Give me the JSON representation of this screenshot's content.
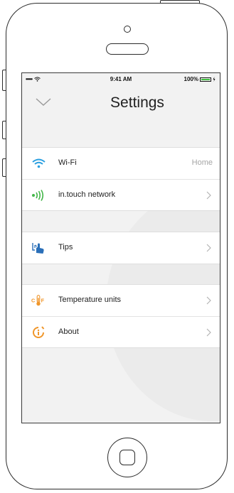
{
  "status": {
    "time": "9:41 AM",
    "battery_text": "100%",
    "signal": "•••••",
    "battery_level": 1.0
  },
  "header": {
    "title": "Settings"
  },
  "groups": [
    {
      "rows": [
        {
          "label": "Wi-Fi",
          "value": "Home",
          "icon": "wifi-icon"
        },
        {
          "label": "in.touch network",
          "icon": "network-signal-icon"
        }
      ]
    },
    {
      "rows": [
        {
          "label": "Tips",
          "icon": "hand-tips-icon"
        }
      ]
    },
    {
      "rows": [
        {
          "label": "Temperature units",
          "icon": "thermometer-icon",
          "icon_text_c": "C",
          "icon_text_f": "F"
        },
        {
          "label": "About",
          "icon": "info-icon"
        }
      ]
    }
  ],
  "colors": {
    "accent_blue": "#2a9fe0",
    "accent_green": "#43b649",
    "accent_orange": "#f0962a"
  }
}
